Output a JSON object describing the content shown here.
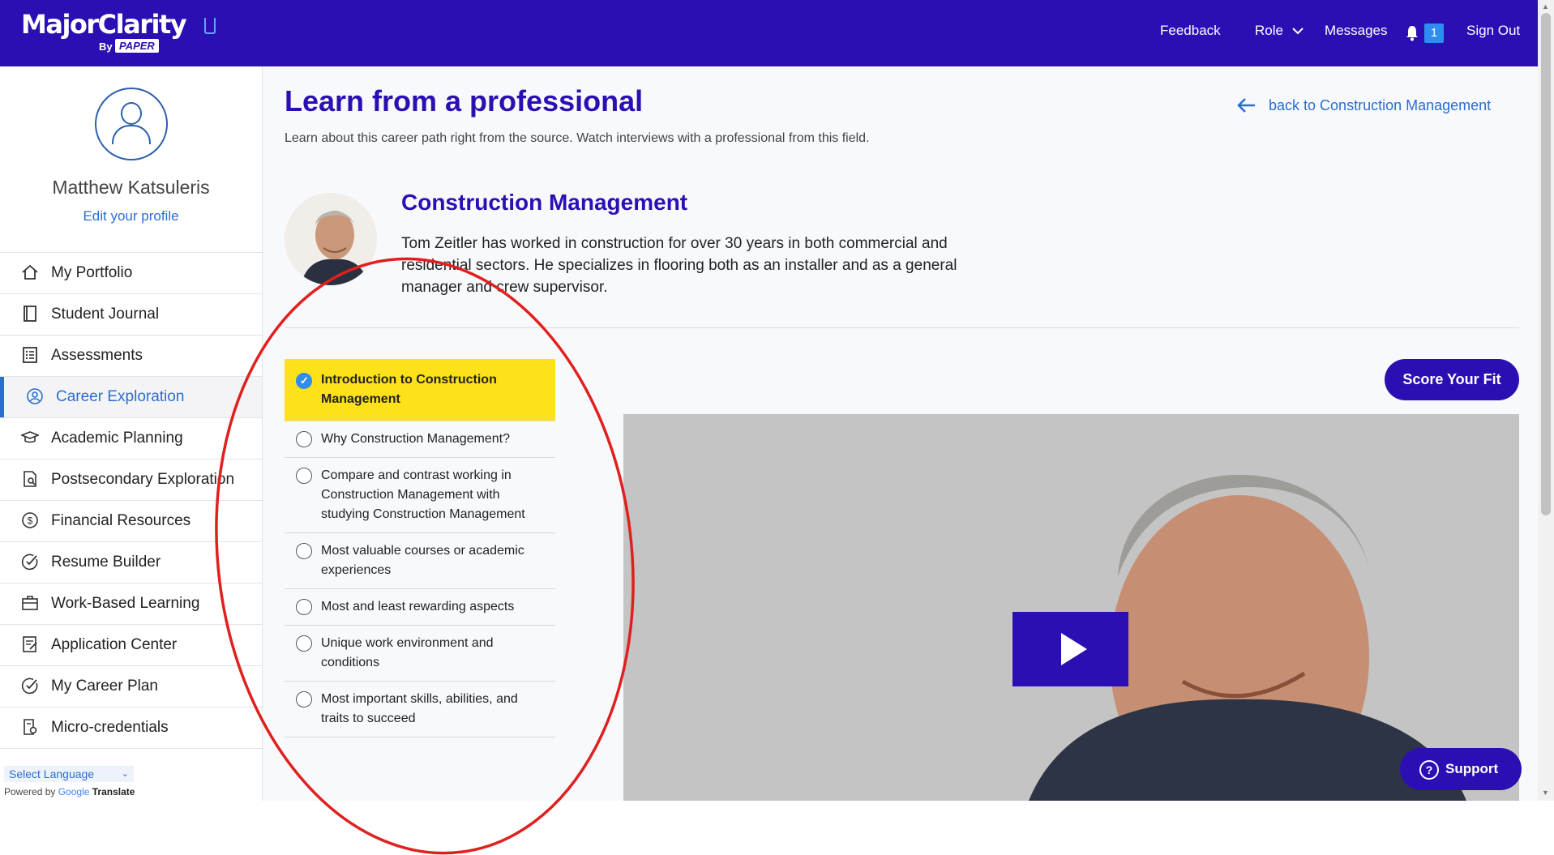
{
  "header": {
    "logo_text": "MajorClarity",
    "logo_by": "By",
    "logo_paper": "PAPER",
    "nav": {
      "feedback": "Feedback",
      "role": "Role",
      "messages": "Messages",
      "notification_count": "1",
      "sign_out": "Sign Out"
    }
  },
  "sidebar": {
    "user_name": "Matthew Katsuleris",
    "edit_profile": "Edit your profile",
    "items": [
      {
        "label": "My Portfolio",
        "icon": "home-icon",
        "active": false
      },
      {
        "label": "Student Journal",
        "icon": "journal-icon",
        "active": false
      },
      {
        "label": "Assessments",
        "icon": "checklist-icon",
        "active": false
      },
      {
        "label": "Career Exploration",
        "icon": "person-circle-icon",
        "active": true
      },
      {
        "label": "Academic Planning",
        "icon": "graduation-cap-icon",
        "active": false
      },
      {
        "label": "Postsecondary Exploration",
        "icon": "document-search-icon",
        "active": false
      },
      {
        "label": "Financial Resources",
        "icon": "dollar-icon",
        "active": false
      },
      {
        "label": "Resume Builder",
        "icon": "check-circle-icon",
        "active": false
      },
      {
        "label": "Work-Based Learning",
        "icon": "briefcase-icon",
        "active": false
      },
      {
        "label": "Application Center",
        "icon": "application-icon",
        "active": false
      },
      {
        "label": "My Career Plan",
        "icon": "check-circle-icon",
        "active": false
      },
      {
        "label": "Micro-credentials",
        "icon": "certificate-icon",
        "active": false
      }
    ],
    "language_select": "Select Language",
    "powered_by": "Powered by",
    "google": "Google",
    "translate": "Translate"
  },
  "main": {
    "title": "Learn from a professional",
    "subtitle": "Learn about this career path right from the source. Watch interviews with a professional from this field.",
    "back_link": "back to Construction Management",
    "professional": {
      "career": "Construction Management",
      "bio": "Tom Zeitler has worked in construction for over 30 years in both commercial and residential sectors. He specializes in flooring both as an installer and as a general manager and crew supervisor."
    },
    "score_button": "Score Your Fit",
    "topics": [
      {
        "label": "Introduction to Construction Management",
        "selected": true
      },
      {
        "label": "Why Construction Management?",
        "selected": false
      },
      {
        "label": "Compare and contrast working in Construction Management with studying Construction Management",
        "selected": false
      },
      {
        "label": "Most valuable courses or academic experiences",
        "selected": false
      },
      {
        "label": "Most and least rewarding aspects",
        "selected": false
      },
      {
        "label": "Unique work environment and conditions",
        "selected": false
      },
      {
        "label": "Most important skills, abilities, and traits to succeed",
        "selected": false
      }
    ]
  },
  "support_button": "Support",
  "colors": {
    "brand": "#2c0fb3",
    "link": "#2b6dd1",
    "highlight": "#fde11a",
    "annotation": "#e0201e"
  }
}
